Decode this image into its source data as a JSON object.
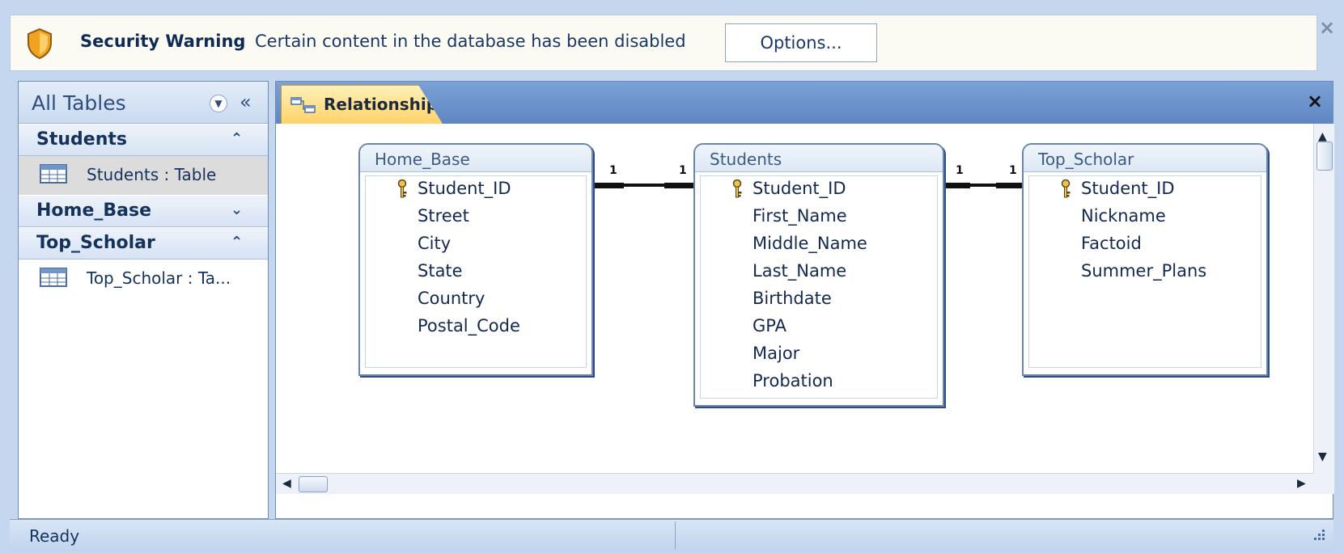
{
  "security_bar": {
    "title": "Security Warning",
    "message": "Certain content in the database has been disabled",
    "options_label": "Options...",
    "close_symbol": "×"
  },
  "nav_pane": {
    "header": "All Tables",
    "collapse_symbol": "«",
    "groups": [
      {
        "name": "Students",
        "expanded": true,
        "chevron": "⌃",
        "items": [
          {
            "label": "Students : Table",
            "icon": "table-icon",
            "selected": true
          }
        ]
      },
      {
        "name": "Home_Base",
        "expanded": false,
        "chevron": "⌄",
        "items": []
      },
      {
        "name": "Top_Scholar",
        "expanded": true,
        "chevron": "⌃",
        "items": [
          {
            "label": "Top_Scholar : Ta...",
            "icon": "table-icon",
            "selected": false
          }
        ]
      }
    ]
  },
  "document": {
    "tab_label": "Relationships",
    "tab_icon": "relationships-icon",
    "close_symbol": "×",
    "tables": [
      {
        "name": "Home_Base",
        "fields": [
          {
            "name": "Student_ID",
            "key": true
          },
          {
            "name": "Street"
          },
          {
            "name": "City"
          },
          {
            "name": "State"
          },
          {
            "name": "Country"
          },
          {
            "name": "Postal_Code"
          }
        ]
      },
      {
        "name": "Students",
        "fields": [
          {
            "name": "Student_ID",
            "key": true
          },
          {
            "name": "First_Name"
          },
          {
            "name": "Middle_Name"
          },
          {
            "name": "Last_Name"
          },
          {
            "name": "Birthdate"
          },
          {
            "name": "GPA"
          },
          {
            "name": "Major"
          },
          {
            "name": "Probation"
          }
        ]
      },
      {
        "name": "Top_Scholar",
        "fields": [
          {
            "name": "Student_ID",
            "key": true
          },
          {
            "name": "Nickname"
          },
          {
            "name": "Factoid"
          },
          {
            "name": "Summer_Plans"
          }
        ]
      }
    ],
    "relationships": [
      {
        "from": "Home_Base.Student_ID",
        "to": "Students.Student_ID",
        "from_card": "1",
        "to_card": "1"
      },
      {
        "from": "Students.Student_ID",
        "to": "Top_Scholar.Student_ID",
        "from_card": "1",
        "to_card": "1"
      }
    ]
  },
  "status_bar": {
    "text": "Ready"
  },
  "colors": {
    "accent": "#ffd26a",
    "frame": "#c5d7ee",
    "tabstrip": "#6a90c8",
    "text": "#15325c"
  }
}
